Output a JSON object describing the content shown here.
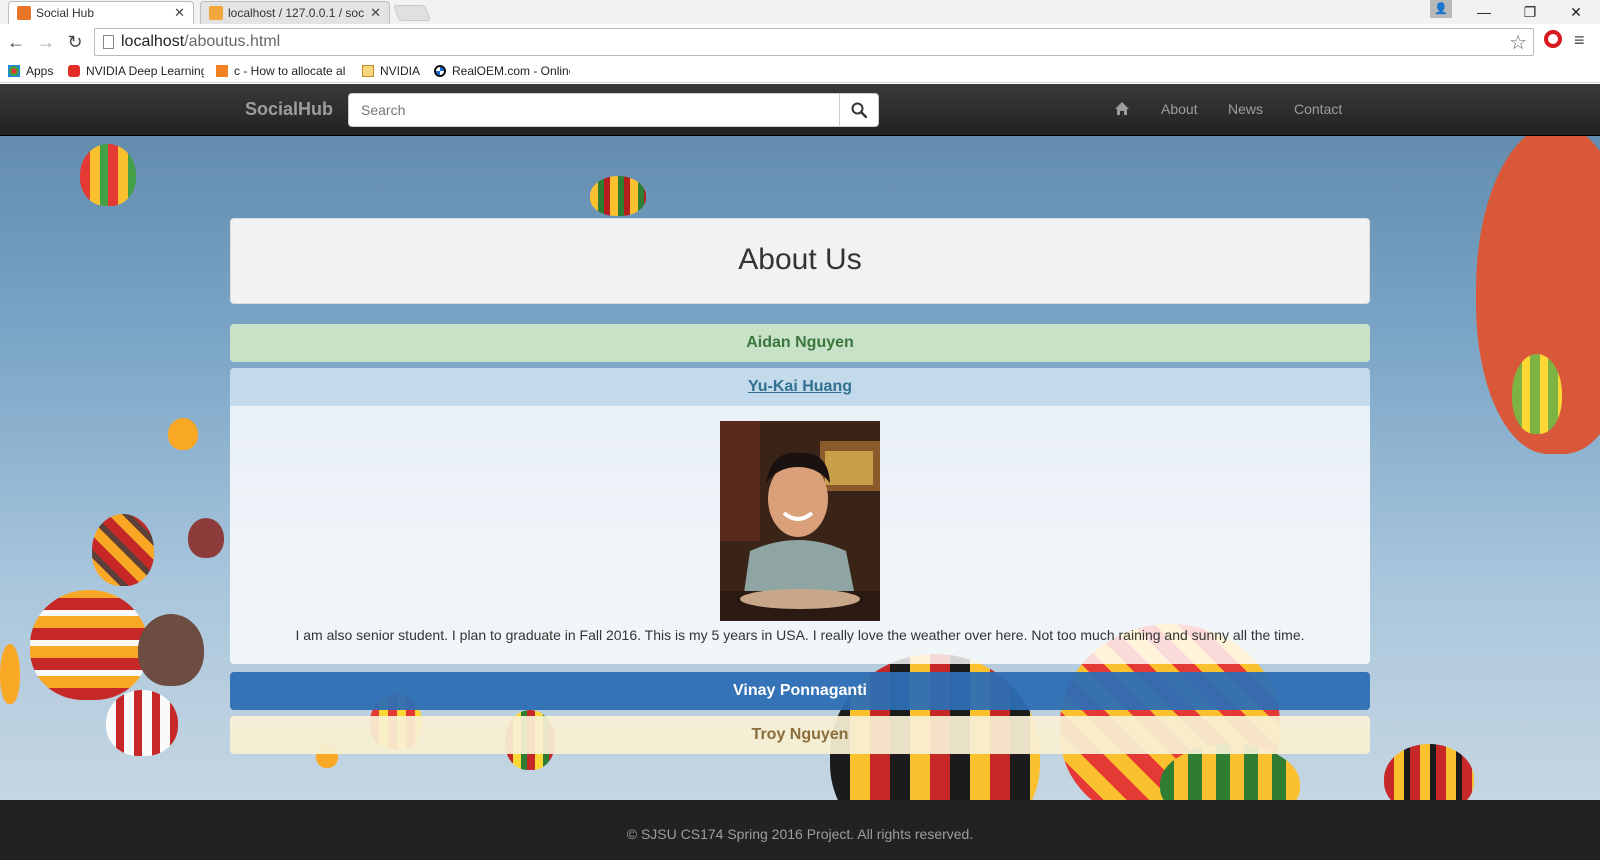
{
  "browser": {
    "tabs": [
      {
        "title": "Social Hub",
        "active": true
      },
      {
        "title": "localhost / 127.0.0.1 / soc",
        "active": false
      }
    ],
    "url_host": "localhost",
    "url_path": "/aboutus.html",
    "bookmarks": [
      {
        "label": "Apps",
        "icon": "apps-icon"
      },
      {
        "label": "NVIDIA Deep Learning",
        "icon": "youtube-icon"
      },
      {
        "label": "c - How to allocate al",
        "icon": "stackoverflow-icon"
      },
      {
        "label": "NVIDIA",
        "icon": "folder-icon"
      },
      {
        "label": "RealOEM.com - Online",
        "icon": "bmw-icon"
      }
    ]
  },
  "navbar": {
    "brand": "SocialHub",
    "search_placeholder": "Search",
    "links": [
      "About",
      "News",
      "Contact"
    ]
  },
  "main": {
    "title": "About Us",
    "members": [
      {
        "name": "Aidan Nguyen",
        "expanded": false,
        "color": "#dff0d8"
      },
      {
        "name": "Yu-Kai Huang",
        "expanded": true,
        "color": "#d9edf7",
        "bio": "I am also senior student. I plan to graduate in Fall 2016. This is my 5 years in USA. I really love the weather over here. Not too much raining and sunny all the time."
      },
      {
        "name": "Vinay Ponnaganti",
        "expanded": false,
        "color": "#337ab7"
      },
      {
        "name": "Troy Nguyen",
        "expanded": false,
        "color": "#fcf8e3"
      }
    ]
  },
  "footer": {
    "text": "© SJSU CS174 Spring 2016 Project. All rights reserved."
  }
}
